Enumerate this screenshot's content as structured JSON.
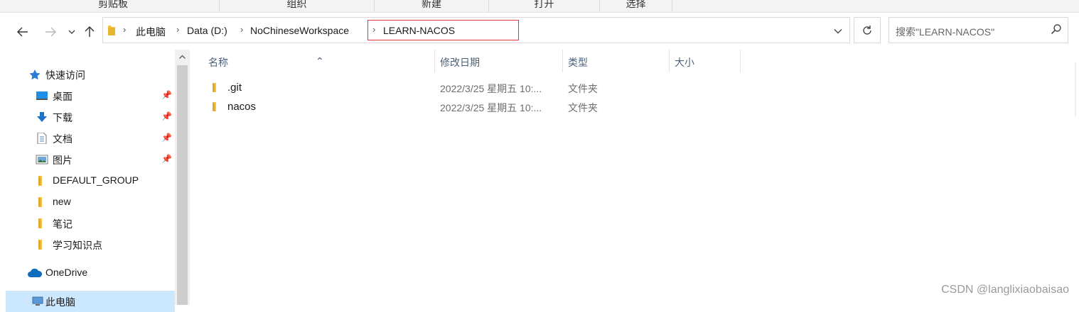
{
  "ribbon": {
    "groups": [
      "剪贴板",
      "组织",
      "新建",
      "打开",
      "选择"
    ]
  },
  "nav": {
    "back_icon": "back-arrow-icon",
    "forward_icon": "forward-arrow-icon",
    "recent_icon": "chevron-down-icon",
    "up_icon": "up-arrow-icon"
  },
  "address": {
    "breadcrumbs": [
      "此电脑",
      "Data (D:)",
      "NoChineseWorkspace",
      "LEARN-NACOS"
    ],
    "highlight_color": "#e0363d"
  },
  "search": {
    "placeholder": "搜索\"LEARN-NACOS\""
  },
  "sidebar": {
    "quick_access": "快速访问",
    "items": [
      {
        "label": "桌面",
        "icon": "desktop-icon",
        "pinned": true
      },
      {
        "label": "下载",
        "icon": "download-icon",
        "pinned": true
      },
      {
        "label": "文档",
        "icon": "document-icon",
        "pinned": true
      },
      {
        "label": "图片",
        "icon": "picture-icon",
        "pinned": true
      },
      {
        "label": "DEFAULT_GROUP",
        "icon": "folder-icon",
        "pinned": false
      },
      {
        "label": "new",
        "icon": "folder-icon",
        "pinned": false
      },
      {
        "label": "笔记",
        "icon": "folder-icon",
        "pinned": false
      },
      {
        "label": "学习知识点",
        "icon": "folder-icon",
        "pinned": false
      }
    ],
    "onedrive": "OneDrive",
    "this_pc": "此电脑"
  },
  "columns": {
    "name": "名称",
    "modified": "修改日期",
    "type": "类型",
    "size": "大小"
  },
  "files": [
    {
      "name": ".git",
      "modified": "2022/3/25 星期五 10:...",
      "type": "文件夹"
    },
    {
      "name": "nacos",
      "modified": "2022/3/25 星期五 10:...",
      "type": "文件夹"
    }
  ],
  "watermark": "CSDN @langlixiaobaisao",
  "colors": {
    "folder": "#f5c342",
    "selection": "#cce8ff",
    "header_text": "#4c607a",
    "onedrive": "#0f6cbd",
    "quick_access_star": "#2b7cd3"
  }
}
